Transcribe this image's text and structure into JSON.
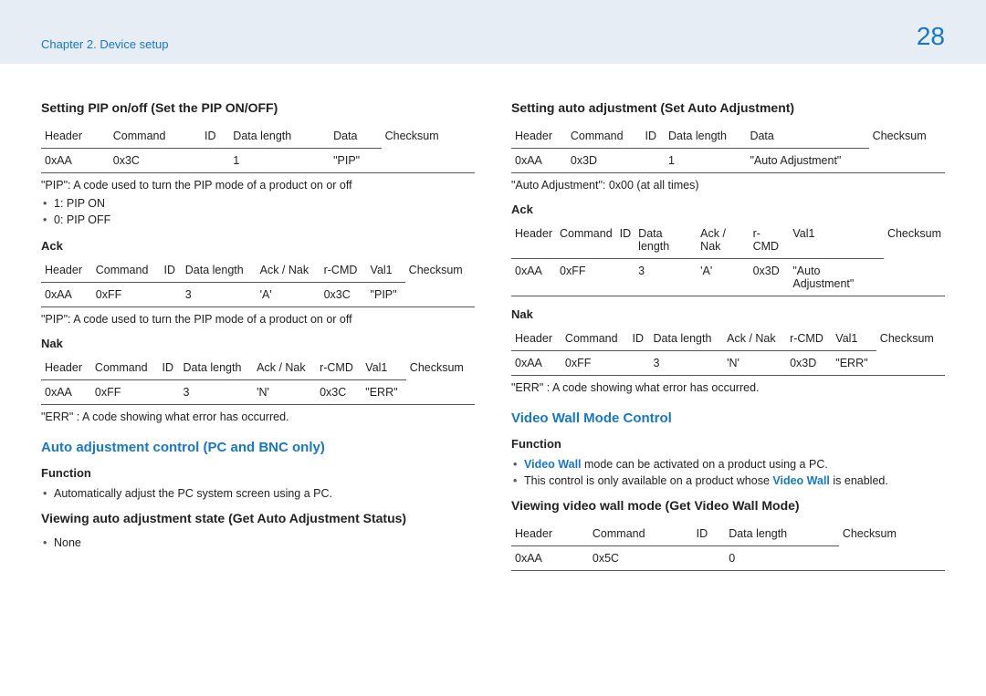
{
  "header": {
    "chapter": "Chapter 2. Device setup",
    "page": "28"
  },
  "left": {
    "s1": {
      "title": "Setting PIP on/off (Set the PIP ON/OFF)",
      "thead": [
        "Header",
        "Command",
        "ID",
        "Data length",
        "Data",
        "Checksum"
      ],
      "row": [
        "0xAA",
        "0x3C",
        "",
        "1",
        "\"PIP\"",
        ""
      ],
      "note": "\"PIP\": A code used to turn the PIP mode of a product on or off",
      "bullets": [
        "1: PIP ON",
        "0: PIP OFF"
      ]
    },
    "ack": {
      "title": "Ack",
      "thead": [
        "Header",
        "Command",
        "ID",
        "Data length",
        "Ack / Nak",
        "r-CMD",
        "Val1",
        "Checksum"
      ],
      "row": [
        "0xAA",
        "0xFF",
        "",
        "3",
        "'A'",
        "0x3C",
        "\"PIP\"",
        ""
      ],
      "note": "\"PIP\": A code used to turn the PIP mode of a product on or off"
    },
    "nak": {
      "title": "Nak",
      "thead": [
        "Header",
        "Command",
        "ID",
        "Data length",
        "Ack / Nak",
        "r-CMD",
        "Val1",
        "Checksum"
      ],
      "row": [
        "0xAA",
        "0xFF",
        "",
        "3",
        "'N'",
        "0x3C",
        "\"ERR\"",
        ""
      ],
      "note": "\"ERR\" : A code showing what error has occurred."
    },
    "auto": {
      "title": "Auto adjustment control (PC and BNC only)",
      "func_h": "Function",
      "func_b": "Automatically adjust the PC system screen using a PC.",
      "view_h": "Viewing auto adjustment state (Get Auto Adjustment Status)",
      "view_b": "None"
    }
  },
  "right": {
    "s1": {
      "title": "Setting auto adjustment (Set Auto Adjustment)",
      "thead": [
        "Header",
        "Command",
        "ID",
        "Data length",
        "Data",
        "Checksum"
      ],
      "row": [
        "0xAA",
        "0x3D",
        "",
        "1",
        "\"Auto Adjustment\"",
        ""
      ],
      "note": "\"Auto Adjustment\": 0x00 (at all times)"
    },
    "ack": {
      "title": "Ack",
      "thead": [
        "Header",
        "Command",
        "ID",
        "Data length",
        "Ack / Nak",
        "r-CMD",
        "Val1",
        "Checksum"
      ],
      "row": [
        "0xAA",
        "0xFF",
        "",
        "3",
        "'A'",
        "0x3D",
        "\"Auto Adjustment\"",
        ""
      ]
    },
    "nak": {
      "title": "Nak",
      "thead": [
        "Header",
        "Command",
        "ID",
        "Data length",
        "Ack / Nak",
        "r-CMD",
        "Val1",
        "Checksum"
      ],
      "row": [
        "0xAA",
        "0xFF",
        "",
        "3",
        "'N'",
        "0x3D",
        "\"ERR\"",
        ""
      ],
      "note": "\"ERR\" : A code showing what error has occurred."
    },
    "vw": {
      "title": "Video Wall Mode Control",
      "func_h": "Function",
      "b1_a": "Video Wall",
      "b1_b": " mode can be activated on a product using a PC.",
      "b2_a": "This control is only available on a product whose ",
      "b2_b": "Video Wall",
      "b2_c": " is enabled.",
      "view_h": "Viewing video wall mode (Get Video Wall Mode)",
      "thead": [
        "Header",
        "Command",
        "ID",
        "Data length",
        "Checksum"
      ],
      "row": [
        "0xAA",
        "0x5C",
        "",
        "0",
        ""
      ]
    }
  }
}
